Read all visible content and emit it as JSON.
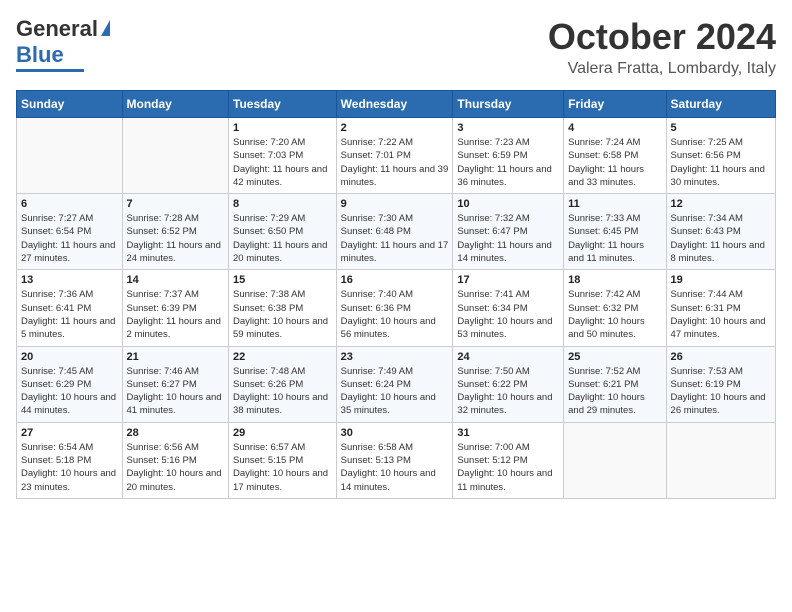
{
  "header": {
    "logo_line1": "General",
    "logo_line2": "Blue",
    "month": "October 2024",
    "location": "Valera Fratta, Lombardy, Italy"
  },
  "days_of_week": [
    "Sunday",
    "Monday",
    "Tuesday",
    "Wednesday",
    "Thursday",
    "Friday",
    "Saturday"
  ],
  "weeks": [
    [
      {
        "day": "",
        "info": ""
      },
      {
        "day": "",
        "info": ""
      },
      {
        "day": "1",
        "info": "Sunrise: 7:20 AM\nSunset: 7:03 PM\nDaylight: 11 hours and 42 minutes."
      },
      {
        "day": "2",
        "info": "Sunrise: 7:22 AM\nSunset: 7:01 PM\nDaylight: 11 hours and 39 minutes."
      },
      {
        "day": "3",
        "info": "Sunrise: 7:23 AM\nSunset: 6:59 PM\nDaylight: 11 hours and 36 minutes."
      },
      {
        "day": "4",
        "info": "Sunrise: 7:24 AM\nSunset: 6:58 PM\nDaylight: 11 hours and 33 minutes."
      },
      {
        "day": "5",
        "info": "Sunrise: 7:25 AM\nSunset: 6:56 PM\nDaylight: 11 hours and 30 minutes."
      }
    ],
    [
      {
        "day": "6",
        "info": "Sunrise: 7:27 AM\nSunset: 6:54 PM\nDaylight: 11 hours and 27 minutes."
      },
      {
        "day": "7",
        "info": "Sunrise: 7:28 AM\nSunset: 6:52 PM\nDaylight: 11 hours and 24 minutes."
      },
      {
        "day": "8",
        "info": "Sunrise: 7:29 AM\nSunset: 6:50 PM\nDaylight: 11 hours and 20 minutes."
      },
      {
        "day": "9",
        "info": "Sunrise: 7:30 AM\nSunset: 6:48 PM\nDaylight: 11 hours and 17 minutes."
      },
      {
        "day": "10",
        "info": "Sunrise: 7:32 AM\nSunset: 6:47 PM\nDaylight: 11 hours and 14 minutes."
      },
      {
        "day": "11",
        "info": "Sunrise: 7:33 AM\nSunset: 6:45 PM\nDaylight: 11 hours and 11 minutes."
      },
      {
        "day": "12",
        "info": "Sunrise: 7:34 AM\nSunset: 6:43 PM\nDaylight: 11 hours and 8 minutes."
      }
    ],
    [
      {
        "day": "13",
        "info": "Sunrise: 7:36 AM\nSunset: 6:41 PM\nDaylight: 11 hours and 5 minutes."
      },
      {
        "day": "14",
        "info": "Sunrise: 7:37 AM\nSunset: 6:39 PM\nDaylight: 11 hours and 2 minutes."
      },
      {
        "day": "15",
        "info": "Sunrise: 7:38 AM\nSunset: 6:38 PM\nDaylight: 10 hours and 59 minutes."
      },
      {
        "day": "16",
        "info": "Sunrise: 7:40 AM\nSunset: 6:36 PM\nDaylight: 10 hours and 56 minutes."
      },
      {
        "day": "17",
        "info": "Sunrise: 7:41 AM\nSunset: 6:34 PM\nDaylight: 10 hours and 53 minutes."
      },
      {
        "day": "18",
        "info": "Sunrise: 7:42 AM\nSunset: 6:32 PM\nDaylight: 10 hours and 50 minutes."
      },
      {
        "day": "19",
        "info": "Sunrise: 7:44 AM\nSunset: 6:31 PM\nDaylight: 10 hours and 47 minutes."
      }
    ],
    [
      {
        "day": "20",
        "info": "Sunrise: 7:45 AM\nSunset: 6:29 PM\nDaylight: 10 hours and 44 minutes."
      },
      {
        "day": "21",
        "info": "Sunrise: 7:46 AM\nSunset: 6:27 PM\nDaylight: 10 hours and 41 minutes."
      },
      {
        "day": "22",
        "info": "Sunrise: 7:48 AM\nSunset: 6:26 PM\nDaylight: 10 hours and 38 minutes."
      },
      {
        "day": "23",
        "info": "Sunrise: 7:49 AM\nSunset: 6:24 PM\nDaylight: 10 hours and 35 minutes."
      },
      {
        "day": "24",
        "info": "Sunrise: 7:50 AM\nSunset: 6:22 PM\nDaylight: 10 hours and 32 minutes."
      },
      {
        "day": "25",
        "info": "Sunrise: 7:52 AM\nSunset: 6:21 PM\nDaylight: 10 hours and 29 minutes."
      },
      {
        "day": "26",
        "info": "Sunrise: 7:53 AM\nSunset: 6:19 PM\nDaylight: 10 hours and 26 minutes."
      }
    ],
    [
      {
        "day": "27",
        "info": "Sunrise: 6:54 AM\nSunset: 5:18 PM\nDaylight: 10 hours and 23 minutes."
      },
      {
        "day": "28",
        "info": "Sunrise: 6:56 AM\nSunset: 5:16 PM\nDaylight: 10 hours and 20 minutes."
      },
      {
        "day": "29",
        "info": "Sunrise: 6:57 AM\nSunset: 5:15 PM\nDaylight: 10 hours and 17 minutes."
      },
      {
        "day": "30",
        "info": "Sunrise: 6:58 AM\nSunset: 5:13 PM\nDaylight: 10 hours and 14 minutes."
      },
      {
        "day": "31",
        "info": "Sunrise: 7:00 AM\nSunset: 5:12 PM\nDaylight: 10 hours and 11 minutes."
      },
      {
        "day": "",
        "info": ""
      },
      {
        "day": "",
        "info": ""
      }
    ]
  ]
}
